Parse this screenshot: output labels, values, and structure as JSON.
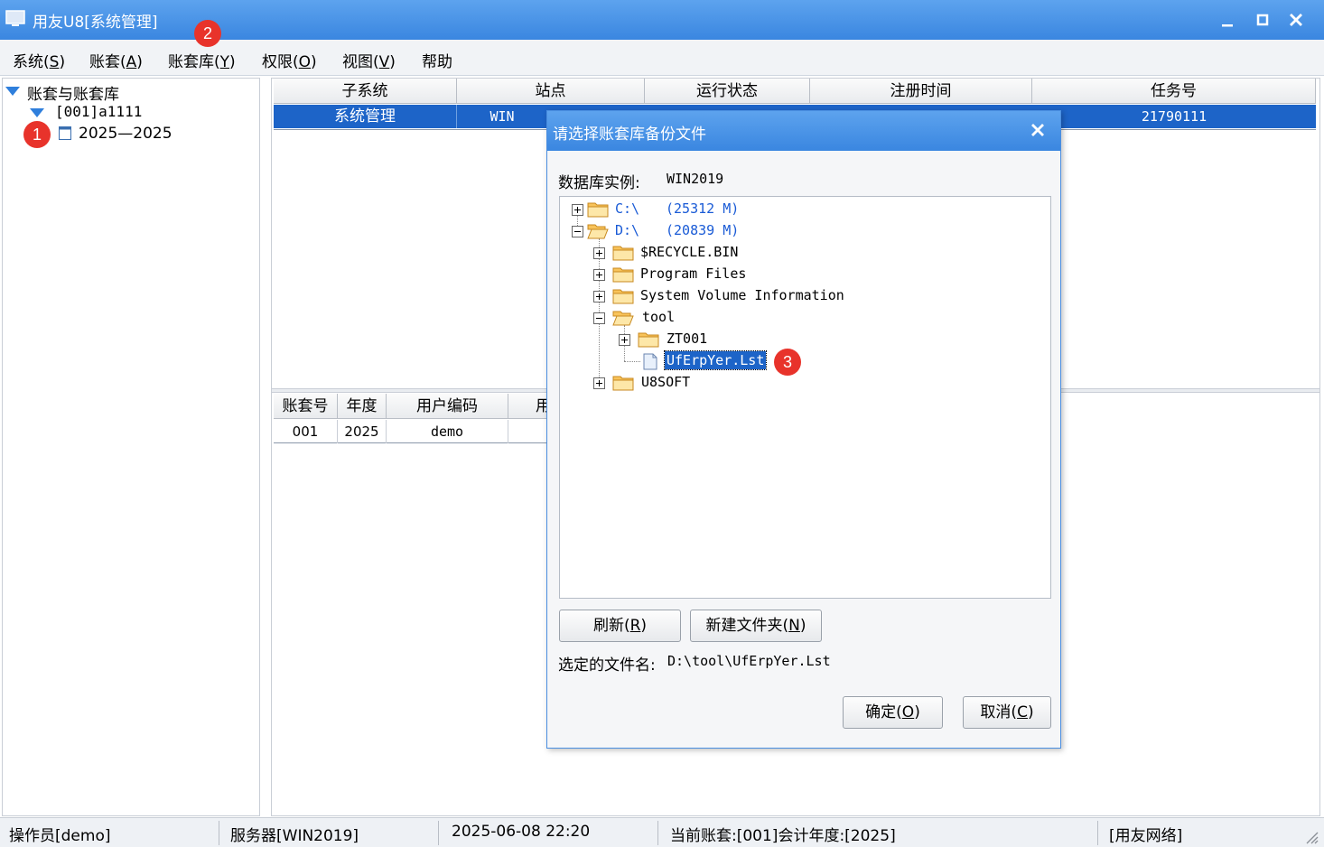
{
  "window": {
    "title": "用友U8[系统管理]"
  },
  "menu": [
    {
      "label": "系统(S)",
      "text": "系统(",
      "key": "S",
      "end": ")"
    },
    {
      "label": "账套(A)",
      "text": "账套(",
      "key": "A",
      "end": ")"
    },
    {
      "label": "账套库(Y)",
      "text": "账套库(",
      "key": "Y",
      "end": ")"
    },
    {
      "label": "权限(O)",
      "text": "权限(",
      "key": "O",
      "end": ")"
    },
    {
      "label": "视图(V)",
      "text": "视图(",
      "key": "V",
      "end": ")"
    },
    {
      "label": "帮助",
      "text": "帮助",
      "key": "",
      "end": ""
    }
  ],
  "tree": {
    "root": "账套与账套库",
    "account": "[001]a1111",
    "year": "2025—2025"
  },
  "top_table": {
    "headers": [
      "子系统",
      "站点",
      "运行状态",
      "注册时间",
      "任务号"
    ],
    "row": [
      "系统管理",
      "WIN",
      "",
      "",
      "21790111"
    ]
  },
  "bottom_table": {
    "headers": [
      "账套号",
      "年度",
      "用户编码",
      "用"
    ],
    "row": [
      "001",
      "2025",
      "demo"
    ]
  },
  "badges": [
    "1",
    "2",
    "3"
  ],
  "dialog": {
    "title": "请选择账套库备份文件",
    "instance_label": "数据库实例:",
    "instance_value": "WIN2019",
    "nodes": {
      "c_drive": "C:\\",
      "c_size": "(25312 M)",
      "d_drive": "D:\\",
      "d_size": "(20839 M)",
      "recycle": "$RECYCLE.BIN",
      "program_files": "Program Files",
      "sysvol": "System Volume Information",
      "tool": "tool",
      "zt001": "ZT001",
      "lst": "UfErpYer.Lst",
      "u8soft": "U8SOFT"
    },
    "refresh_btn": {
      "text": "刷新(",
      "key": "R",
      "end": ")"
    },
    "newfolder_btn": {
      "text": "新建文件夹(",
      "key": "N",
      "end": ")"
    },
    "selected_label": "选定的文件名:",
    "selected_value": "D:\\tool\\UfErpYer.Lst",
    "ok_btn": {
      "text": "确定(",
      "key": "O",
      "end": ")"
    },
    "cancel_btn": {
      "text": "取消(",
      "key": "C",
      "end": ")"
    }
  },
  "status": {
    "operator": "操作员[demo]",
    "server": "服务器[WIN2019]",
    "datetime": "2025-06-08 22:20",
    "current": "当前账套:[001]会计年度:[2025]",
    "network": "[用友网络]"
  },
  "colors": {
    "titlebar": "#3a86e0",
    "selection": "#1d64c8",
    "badge": "#e8332b"
  }
}
